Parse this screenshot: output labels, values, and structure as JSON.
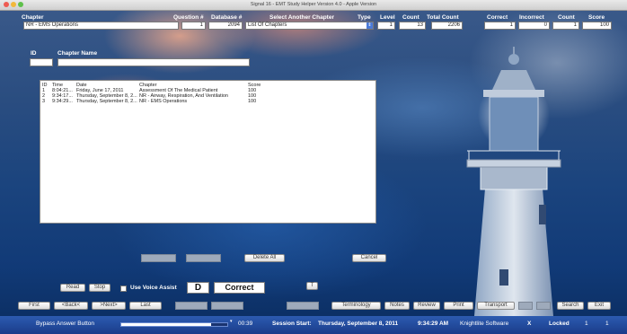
{
  "window": {
    "title": "Signal 16 - EMT Study Helper Version 4.0 - Apple Version"
  },
  "header": {
    "chapter_label": "Chapter",
    "question_label": "Question #",
    "database_label": "Database #",
    "select_chapter_label": "Select Another Chapter",
    "type_label": "Type",
    "level_label": "Level",
    "count_label": "Count",
    "total_count_label": "Total Count",
    "correct_label": "Correct",
    "incorrect_label": "Incorrect",
    "count2_label": "Count",
    "score_label": "Score",
    "chapter_value": "NR - EMS Operations",
    "question_value": "1",
    "database_value": "2094",
    "select_chapter_value": "List Of Chapters",
    "level_value": "1",
    "count_value": "13",
    "total_count_value": "2206",
    "correct_value": "1",
    "incorrect_value": "0",
    "count2_value": "1",
    "score_value": "100"
  },
  "id_section": {
    "id_label": "ID",
    "chapter_name_label": "Chapter Name",
    "id_value": "",
    "chapter_name_value": ""
  },
  "list": {
    "headers": [
      "ID",
      "Time",
      "Date",
      "Chapter",
      "Score"
    ],
    "rows": [
      [
        "1",
        "8:04:21...",
        "Friday, June 17, 2011",
        "Assessment Of The Medical Patient",
        "100"
      ],
      [
        "2",
        "9:34:17...",
        "Thursday, September 8, 2...",
        "NR - Airway, Respiration, And Ventilation",
        "100"
      ],
      [
        "3",
        "9:34:29...",
        "Thursday, September 8, 2...",
        "NR - EMS Operations",
        "100"
      ]
    ]
  },
  "buttons": {
    "delete_all": "Delete All",
    "cancel": "Cancel",
    "read": "Read",
    "stop": "Stop",
    "voice_assist": "Use Voice Assist",
    "answer_letter": "D",
    "answer_result": "Correct",
    "t": "T",
    "first": "First",
    "back": "<Back<",
    "next": ">Next>",
    "last": "Last",
    "terminology": "Terminology",
    "notes": "Notes",
    "review": "Review",
    "print": "Print",
    "transport": "Transport",
    "search": "Search",
    "exit": "Exit"
  },
  "status": {
    "bypass": "Bypass Answer Button",
    "progress": 0.85,
    "time": "00:39",
    "session_label": "Session Start:",
    "session_date": "Thursday, September 8, 2011",
    "session_time": "9:34:29 AM",
    "company": "Knightlite Software",
    "x": "X",
    "locked": "Locked",
    "n1": "1",
    "n2": "1"
  }
}
